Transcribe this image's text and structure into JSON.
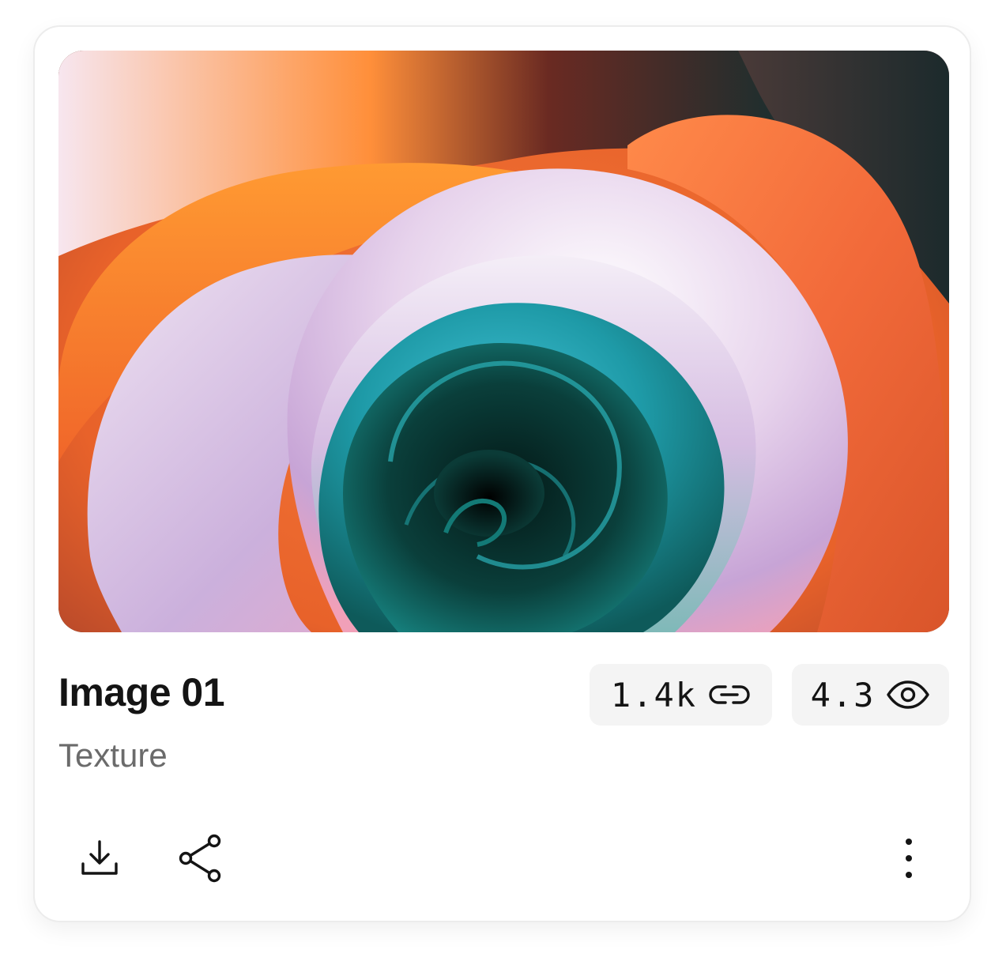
{
  "card": {
    "title": "Image 01",
    "subtitle": "Texture",
    "stats": {
      "links": {
        "value": "1.4k",
        "icon": "link-icon"
      },
      "views": {
        "value": "4.3",
        "icon": "eye-icon"
      }
    },
    "actions": {
      "download": {
        "icon": "download-icon"
      },
      "share": {
        "icon": "share-icon"
      },
      "more": {
        "icon": "more-vertical-icon"
      }
    }
  },
  "colors": {
    "text_primary": "#141414",
    "text_secondary": "#6b6b6b",
    "stat_background": "#f4f4f4",
    "card_border": "#ececec"
  }
}
